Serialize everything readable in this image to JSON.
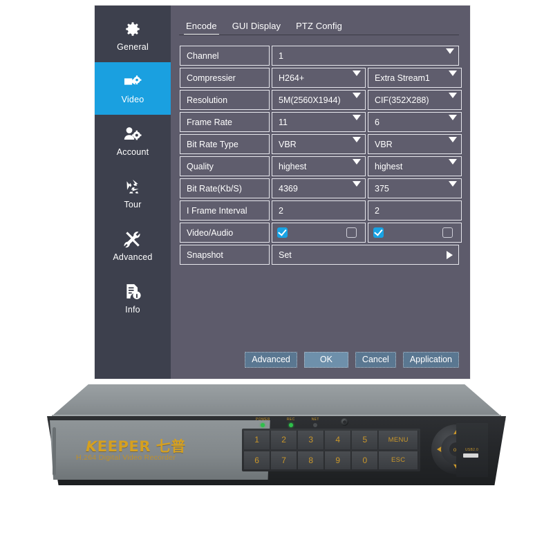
{
  "panel": {
    "sidebar": {
      "items": [
        {
          "label": "General",
          "icon": "gear-icon",
          "active": false
        },
        {
          "label": "Video",
          "icon": "camera-gear-icon",
          "active": true
        },
        {
          "label": "Account",
          "icon": "users-gear-icon",
          "active": false
        },
        {
          "label": "Tour",
          "icon": "recycle-icon",
          "active": false
        },
        {
          "label": "Advanced",
          "icon": "tools-icon",
          "active": false
        },
        {
          "label": "Info",
          "icon": "document-info-icon",
          "active": false
        }
      ]
    },
    "tabs": [
      {
        "label": "Encode",
        "active": true
      },
      {
        "label": "GUI Display",
        "active": false
      },
      {
        "label": "PTZ Config",
        "active": false
      }
    ],
    "table": {
      "rows": [
        {
          "label": "Channel",
          "main": "1",
          "sub": null,
          "main_caret": true,
          "sub_caret": false,
          "span": true
        },
        {
          "label": "Compressier",
          "main": "H264+",
          "sub": "Extra Stream1",
          "main_caret": true,
          "sub_caret": true,
          "span": false
        },
        {
          "label": "Resolution",
          "main": "5M(2560X1944)",
          "sub": "CIF(352X288)",
          "main_caret": true,
          "sub_caret": true,
          "span": false
        },
        {
          "label": "Frame Rate",
          "main": "11",
          "sub": "6",
          "main_caret": true,
          "sub_caret": true,
          "span": false
        },
        {
          "label": "Bit Rate Type",
          "main": "VBR",
          "sub": "VBR",
          "main_caret": true,
          "sub_caret": true,
          "span": false
        },
        {
          "label": "Quality",
          "main": "highest",
          "sub": "highest",
          "main_caret": true,
          "sub_caret": true,
          "span": false
        },
        {
          "label": "Bit Rate(Kb/S)",
          "main": "4369",
          "sub": "375",
          "main_caret": true,
          "sub_caret": true,
          "span": false
        },
        {
          "label": "I Frame Interval",
          "main": "2",
          "sub": "2",
          "main_caret": false,
          "sub_caret": false,
          "span": false
        }
      ],
      "video_audio": {
        "label": "Video/Audio",
        "main_video_checked": true,
        "main_audio_checked": false,
        "sub_video_checked": true,
        "sub_audio_checked": false
      },
      "snapshot": {
        "label": "Snapshot",
        "value": "Set"
      }
    },
    "buttons": [
      {
        "label": "Advanced",
        "primary": false
      },
      {
        "label": "OK",
        "primary": true
      },
      {
        "label": "Cancel",
        "primary": false
      },
      {
        "label": "Application",
        "primary": false
      }
    ],
    "colors": {
      "panel_bg": "#5d5b6b",
      "sidebar_bg": "#3d404d",
      "accent": "#1aa0e0",
      "cell_bg": "#5f5d6d",
      "cell_border": "#e8e8ee",
      "button_bg": "#5a7791"
    }
  },
  "device": {
    "brand": "EEPER 七普",
    "brand_prefix": "K",
    "subtitle": "H.264 Digital Video Recorder",
    "keys_row1": [
      "1",
      "2",
      "3",
      "4",
      "5"
    ],
    "keys_row2": [
      "6",
      "7",
      "8",
      "9",
      "0"
    ],
    "fn_row1": "MENU",
    "fn_row2": "ESC",
    "leds": [
      {
        "label": "POWER",
        "on": true
      },
      {
        "label": "REC",
        "on": true
      },
      {
        "label": "NET",
        "on": false
      }
    ],
    "dpad_center": "ok",
    "usb_label": "USB2.0"
  }
}
